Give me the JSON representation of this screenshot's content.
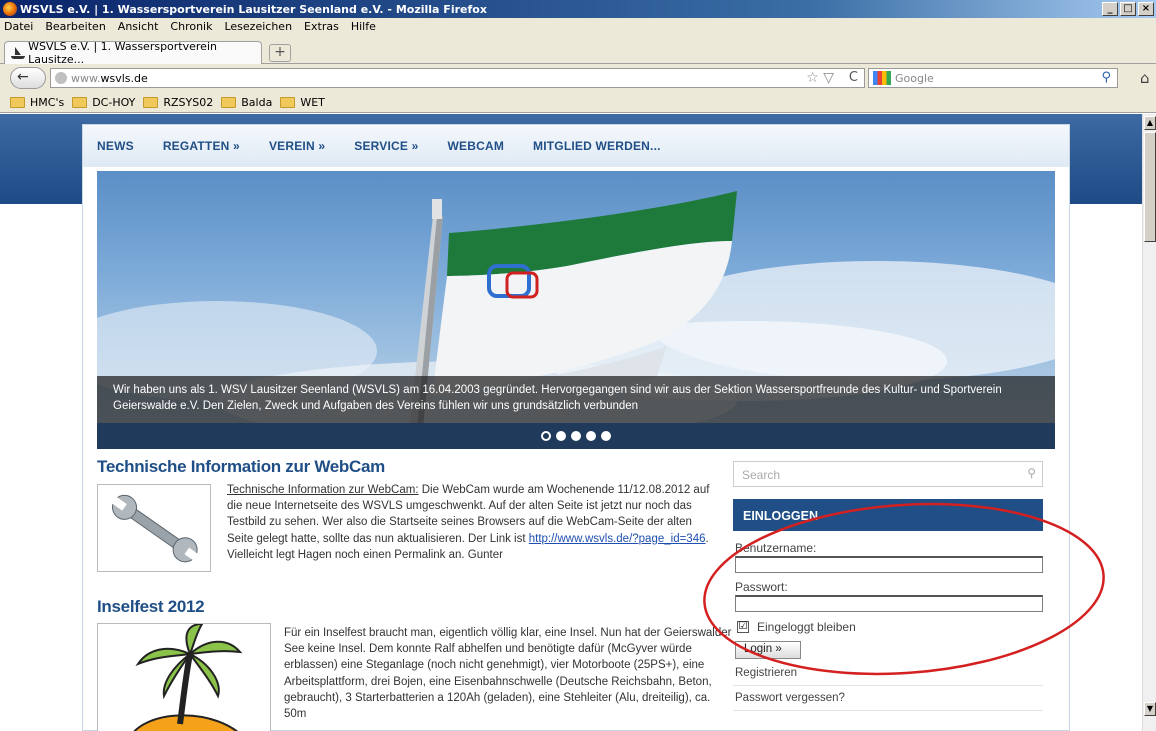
{
  "window": {
    "title": "WSVLS e.V. | 1. Wassersportverein Lausitzer Seenland e.V. - Mozilla Firefox",
    "buttons": {
      "minimize": "_",
      "maximize": "□",
      "close": "×"
    }
  },
  "menubar": [
    "Datei",
    "Bearbeiten",
    "Ansicht",
    "Chronik",
    "Lesezeichen",
    "Extras",
    "Hilfe"
  ],
  "tab": {
    "label": "WSVLS e.V. | 1. Wassersportverein Lausitze...",
    "new_tab": "+"
  },
  "navigation": {
    "url_prefix": "www.",
    "url_domain": "wsvls.de",
    "search_placeholder": "Google",
    "back": "←",
    "star": "☆ ▽",
    "reload": "C",
    "home": "⌂",
    "search_icon": "⚲"
  },
  "bookmarks": [
    "HMC's",
    "DC-HOY",
    "RZSYS02",
    "Balda",
    "WET"
  ],
  "site": {
    "menu": [
      "NEWS",
      "REGATTEN »",
      "VEREIN »",
      "SERVICE »",
      "WEBCAM",
      "MITGLIED WERDEN..."
    ],
    "hero_caption": "Wir haben uns als 1. WSV Lausitzer Seenland (WSVLS) am 16.04.2003 gegründet. Hervorgegangen sind wir aus der Sektion Wassersportfreunde des Kultur- und Sportverein Geierswalde e.V. Den Zielen, Zweck und Aufgaben des Vereins fühlen wir uns grundsätzlich verbunden",
    "slider_dots": 5,
    "posts": [
      {
        "title": "Technische Information zur WebCam",
        "link_text": "Technische Information zur WebCam:",
        "text_1": " Die WebCam wurde am Wochenende 11/12.08.2012 auf die neue Internetseite des WSVLS umgeschwenkt. Auf der alten Seite ist jetzt nur noch das Testbild zu sehen. Wer also die Startseite seines Browsers auf die WebCam-Seite der alten Seite gelegt hatte, sollte das nun aktualisieren. Der Link ist ",
        "url": "http://www.wsvls.de/?page_id=346",
        "text_2": ".  Vielleicht legt Hagen noch einen Permalink an. Gunter"
      },
      {
        "title": "Inselfest 2012",
        "text": "Für ein Inselfest braucht man, eigentlich völlig klar, eine Insel. Nun hat der Geierswalder See keine Insel. Dem konnte Ralf abhelfen und benötigte dafür (McGyver würde erblassen) eine Steganlage (noch nicht genehmigt), vier Motorboote (25PS+), eine Arbeitsplattform, drei Bojen, eine Eisenbahnschwelle (Deutsche Reichsbahn, Beton, gebraucht), 3 Starterbatterien a 120Ah (geladen), eine Stehleiter (Alu, dreiteilig), ca. 50m"
      }
    ],
    "sidebar": {
      "search_placeholder": "Search",
      "login_title": "EINLOGGEN",
      "username_label": "Benutzername:",
      "password_label": "Passwort:",
      "remember_label": "Eingeloggt bleiben",
      "remember_checked": "☑",
      "login_button": "Login »",
      "register_link": "Registrieren",
      "forgot_link": "Passwort vergessen?"
    }
  },
  "colors": {
    "brand_blue": "#1f4f86",
    "annotation_red": "#d42020",
    "flag_green": "#1e7a3a"
  }
}
